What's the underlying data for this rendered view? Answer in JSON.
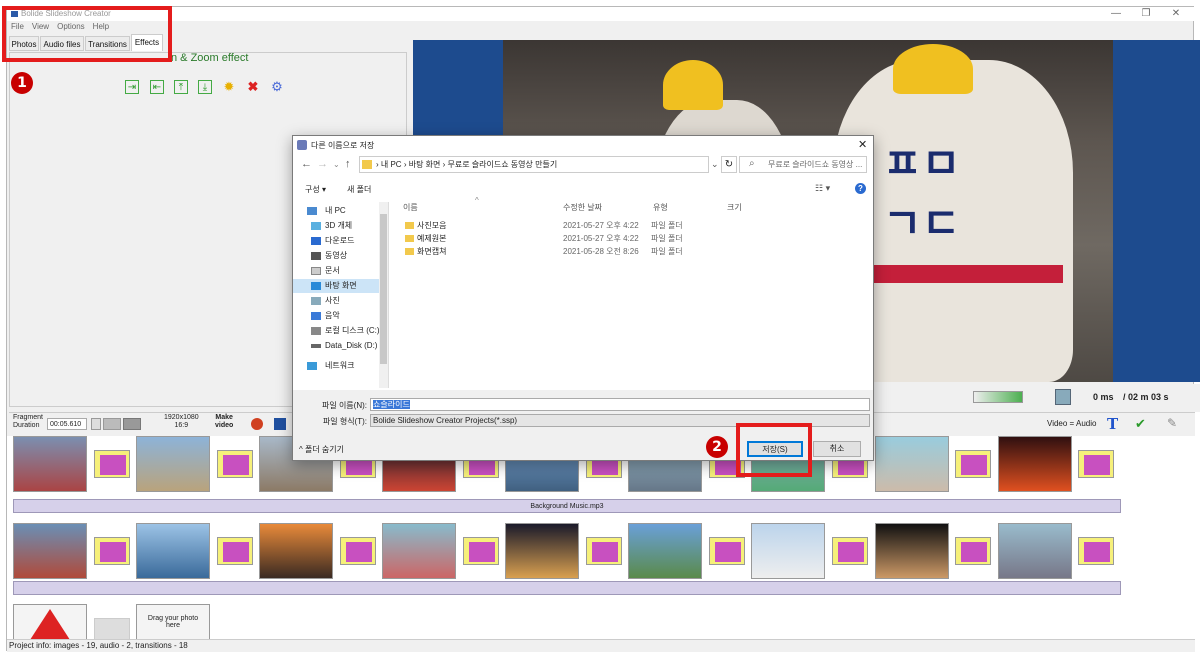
{
  "app": {
    "title": "Bolide Slideshow Creator",
    "menu": [
      "File",
      "View",
      "Options",
      "Help"
    ],
    "tabs": [
      "Photos",
      "Audio files",
      "Transitions",
      "Effects"
    ],
    "active_tab": "Effects",
    "effect_label": "n & Zoom effect",
    "playback_time": "0 ms",
    "total_time": "/ 02 m 03 s",
    "fragment_duration_label": "Fragment\nDuration",
    "fragment_duration_value": "00:05.610",
    "resolution": "1920x1080",
    "aspect": "16:9",
    "make_video": "Make\nvideo",
    "video_audio_label": "Video = Audio",
    "audio_track": "Background Music.mp3",
    "drag_hint": "Drag your photo\nhere",
    "status": "Project info: images - 19, audio - 2, transitions - 18"
  },
  "annotations": {
    "badge1": "1",
    "badge2": "2"
  },
  "dialog": {
    "title": "다른 이름으로 저장",
    "path": [
      "내 PC",
      "바탕 화면",
      "무료로 슬라이드쇼 동영상 만들기"
    ],
    "search_placeholder": "무료로 슬라이드쇼 동영상 ...",
    "organize": "구성 ▾",
    "new_folder": "새 폴더",
    "nav": [
      "내 PC",
      "3D 개체",
      "다운로드",
      "동영상",
      "문서",
      "바탕 화면",
      "사진",
      "음악",
      "로컬 디스크 (C:)",
      "Data_Disk (D:)",
      "네트워크"
    ],
    "selected_nav": "바탕 화면",
    "columns": [
      "이름",
      "수정한 날짜",
      "유형",
      "크기"
    ],
    "files": [
      {
        "name": "사진모음",
        "date": "2021-05-27 오후 4:22",
        "type": "파일 폴더"
      },
      {
        "name": "예제원본",
        "date": "2021-05-27 오후 4:22",
        "type": "파일 폴더"
      },
      {
        "name": "화면캡쳐",
        "date": "2021-05-28 오전 8:26",
        "type": "파일 폴더"
      }
    ],
    "filename_label": "파일 이름(N):",
    "filename_value": "쇼슬라이드",
    "filetype_label": "파일 형식(T):",
    "filetype_value": "Bolide Slideshow Creator Projects(*.ssp)",
    "hide_folders": "폴더 숨기기",
    "save": "저장(S)",
    "cancel": "취소"
  },
  "colors": {
    "accent_red": "#e41c1c",
    "preview_blue": "#1d4b8e",
    "transition_yellow": "#f6f07a",
    "transition_magenta": "#c850c0"
  }
}
